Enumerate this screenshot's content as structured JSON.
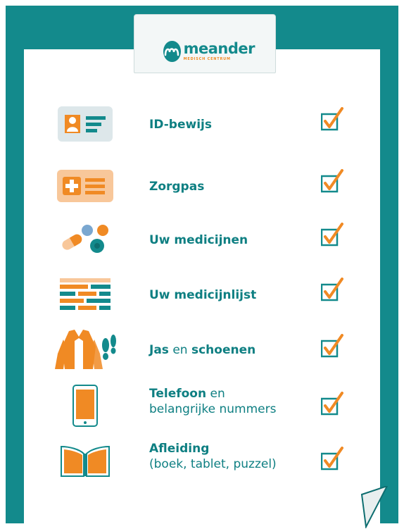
{
  "brand": {
    "name": "meander",
    "tagline": "MEDISCH CENTRUM",
    "colors": {
      "teal": "#138a8c",
      "orange": "#f08a24",
      "text": "#0e7f82"
    }
  },
  "items": [
    {
      "icon": "id-card-icon",
      "bold": "ID-bewijs",
      "regular": "",
      "line2": "",
      "checked": true
    },
    {
      "icon": "insurance-card-icon",
      "bold": "Zorgpas",
      "regular": "",
      "line2": "",
      "checked": true
    },
    {
      "icon": "pills-icon",
      "bold": "Uw medicijnen",
      "regular": "",
      "line2": "",
      "checked": true
    },
    {
      "icon": "medication-list-icon",
      "bold": "Uw medicijnlijst",
      "regular": "",
      "line2": "",
      "checked": true
    },
    {
      "icon": "coat-and-shoes-icon",
      "bold": "Jas",
      "regular": " en ",
      "bold2": "schoenen",
      "line2": "",
      "checked": true
    },
    {
      "icon": "phone-icon",
      "bold": "Telefoon",
      "regular": " en",
      "line2": "belangrijke nummers",
      "checked": true
    },
    {
      "icon": "book-icon",
      "bold": "Afleiding",
      "regular": "",
      "line2": "(boek, tablet, puzzel)",
      "checked": true
    }
  ]
}
